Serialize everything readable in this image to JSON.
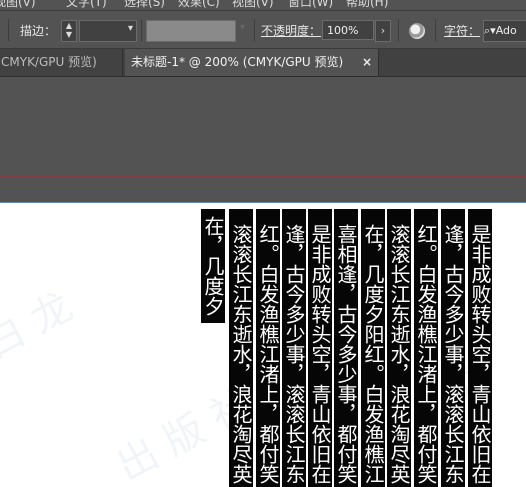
{
  "menu": {
    "items": [
      "视图(V)",
      "文字(T)",
      "选择(S)",
      "效果(C)",
      "视图(V)",
      "窗口(W)",
      "帮助(H)"
    ]
  },
  "control_bar": {
    "stroke_label": "描边：",
    "opacity_label": "不透明度：",
    "opacity_value": "100%",
    "character_label": "字符：",
    "font_search_value": "Ado"
  },
  "tabs": [
    {
      "label": "CMYK/GPU 预览)",
      "active": false
    },
    {
      "label": "未标题-1* @ 200% (CMYK/GPU 预览)",
      "active": true,
      "close": "×"
    }
  ],
  "text_columns": [
    "在，几度夕",
    "滚滚长江东逝水，浪花淘尽英",
    "红。白发渔樵江渚上，都付笑",
    "逢，古今多少事，滚滚长江东",
    "是非成败转头空，青山依旧在",
    "喜相逢，古今多少事，都付笑",
    "在，几度夕阳红。白发渔樵江",
    "滚滚长江东逝水，浪花淘尽英",
    "红。白发渔樵江渚上，都付笑",
    "逢，古今多少事，滚滚长江东",
    "是非成败转头空，青山依旧在"
  ],
  "colors": {
    "ui_background": "#535353",
    "tab_bar": "#414141",
    "artboard": "#ffffff",
    "text_fill": "#000000",
    "guide_red": "#b3262b"
  },
  "icons": [
    "globe-icon",
    "search-icon",
    "chevron-down-icon",
    "close-icon"
  ]
}
